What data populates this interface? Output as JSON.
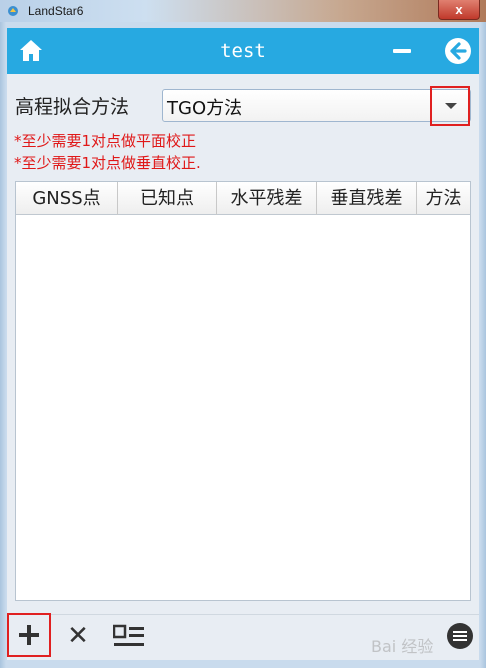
{
  "window": {
    "title": "LandStar6",
    "close_label": "x"
  },
  "header": {
    "title": "test",
    "home_icon": "home-icon",
    "minimize_icon": "minimize-icon",
    "back_icon": "arrow-left-icon",
    "color": "#27a9e1"
  },
  "form": {
    "fit_label": "高程拟合方法",
    "method_value": "TGO方法",
    "warning_1": "*至少需要1对点做平面校正",
    "warning_2": "*至少需要1对点做垂直校正.",
    "warning_color": "#e01818"
  },
  "table": {
    "columns": [
      "GNSS点",
      "已知点",
      "水平残差",
      "垂直残差",
      "方法"
    ],
    "rows": []
  },
  "footer": {
    "add_icon": "plus-icon",
    "delete_label": "✕",
    "list_icon": "list-icon",
    "menu_icon": "menu-icon",
    "watermark": "Bai 经验"
  },
  "highlight_color": "#e02020"
}
